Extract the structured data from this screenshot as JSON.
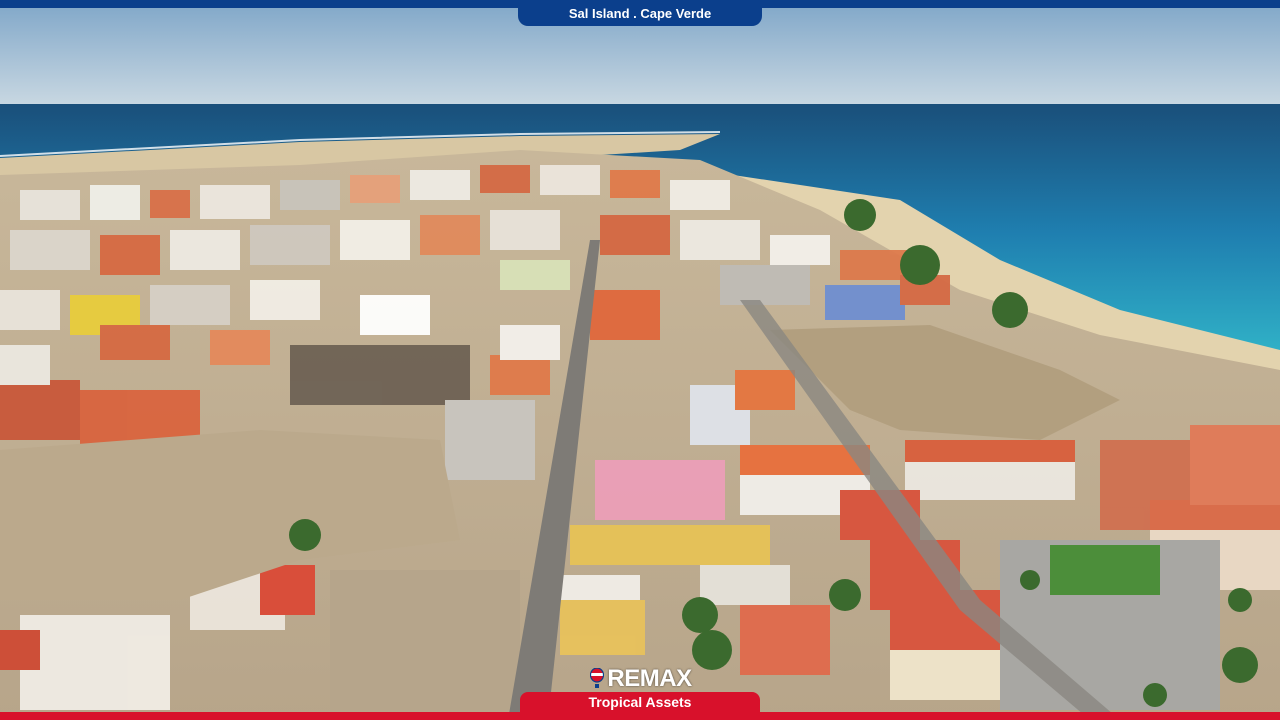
{
  "overlay": {
    "location_title": "Sal Island . Cape Verde",
    "brand_name": "REMAX",
    "brand_tagline": "Tropical Assets"
  },
  "colors": {
    "title_bar": "#0b3f8c",
    "brand_bar": "#d8112b",
    "sea": "#1e8fb8",
    "sand": "#d9c7a0"
  },
  "icons": {
    "brand_logo": "balloon-icon"
  }
}
